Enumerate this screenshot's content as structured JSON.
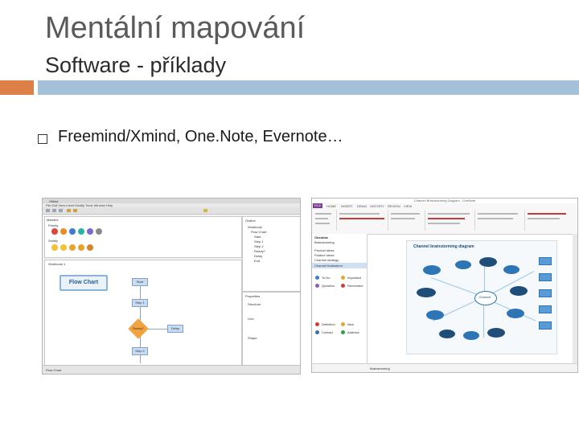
{
  "slide": {
    "title": "Mentální mapování",
    "subtitle": "Software - příklady",
    "bullet": "Freemind/Xmind, One.Note, Evernote…",
    "colors": {
      "accent_orange": "#dd8047",
      "accent_blue": "#a5c1d9"
    }
  },
  "xmind": {
    "window_title": "XMind",
    "menu": "File Edit View Insert Modify Tools Window Help",
    "panel_tab": "Markers",
    "section_priority": "Priority",
    "section_smiley": "Smiley",
    "canvas_tab": "Workbook 1",
    "root_label": "Flow Chart",
    "nodes": {
      "start": "Start",
      "step1": "Step 1",
      "ready": "Ready?",
      "step2": "Step 2",
      "delay": "Delay"
    },
    "outline_tab": "Outline",
    "outline_items": [
      "Workbook",
      "Flow Chart",
      "Start",
      "Step 1",
      "Step 2",
      "Ready?",
      "Delay",
      "End"
    ],
    "props_tab": "Properties",
    "props_items": [
      "Structure",
      "Line",
      "Shape"
    ],
    "status": "Flow Chart"
  },
  "onenote": {
    "window_title": "Channel Brainstorming Diagram - OneNote",
    "file_tab": "FILE",
    "ribbon_tabs": [
      "HOME",
      "INSERT",
      "DRAW",
      "HISTORY",
      "REVIEW",
      "VIEW"
    ],
    "nav_items": [
      "Obsidian",
      "Brainstorming",
      "Product ideas",
      "Feature ideas",
      "Channel strategy",
      "Channel brainstorm"
    ],
    "tag_items": [
      "To Do",
      "Important",
      "Question",
      "Remember",
      "Definition",
      "Idea",
      "Contact",
      "Address"
    ],
    "diagram_title": "Channel brainstorming diagram",
    "center_label": "Channel",
    "status": "Brainstorming"
  }
}
